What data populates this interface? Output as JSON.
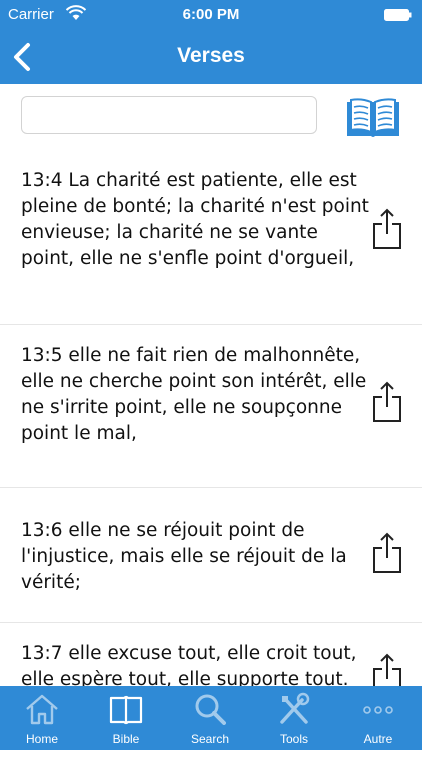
{
  "status_bar": {
    "carrier": "Carrier",
    "time": "6:00 PM"
  },
  "nav": {
    "title": "Verses"
  },
  "search": {
    "value": "",
    "placeholder": ""
  },
  "verses": [
    {
      "text": "13:4 La charité est patiente, elle est pleine de bonté; la charité n'est point envieuse; la charité ne se vante point, elle ne s'enfle point d'orgueil,"
    },
    {
      "text": "13:5 elle ne fait rien de malhonnête, elle ne cherche point son intérêt, elle ne s'irrite point, elle ne soupçonne point le mal,"
    },
    {
      "text": "13:6 elle ne se réjouit point de l'injustice, mais elle se réjouit de la vérité;"
    },
    {
      "text": "13:7 elle excuse tout, elle croit tout, elle espère tout, elle supporte tout."
    }
  ],
  "tabs": [
    {
      "label": "Home",
      "icon": "home-icon",
      "active": false
    },
    {
      "label": "Bible",
      "icon": "book-icon",
      "active": true
    },
    {
      "label": "Search",
      "icon": "search-icon",
      "active": false
    },
    {
      "label": "Tools",
      "icon": "tools-icon",
      "active": false
    },
    {
      "label": "Autre",
      "icon": "more-icon",
      "active": false
    }
  ],
  "colors": {
    "accent": "#2f8ad6",
    "background": "#ffffff",
    "divider": "#e6e6e6"
  }
}
